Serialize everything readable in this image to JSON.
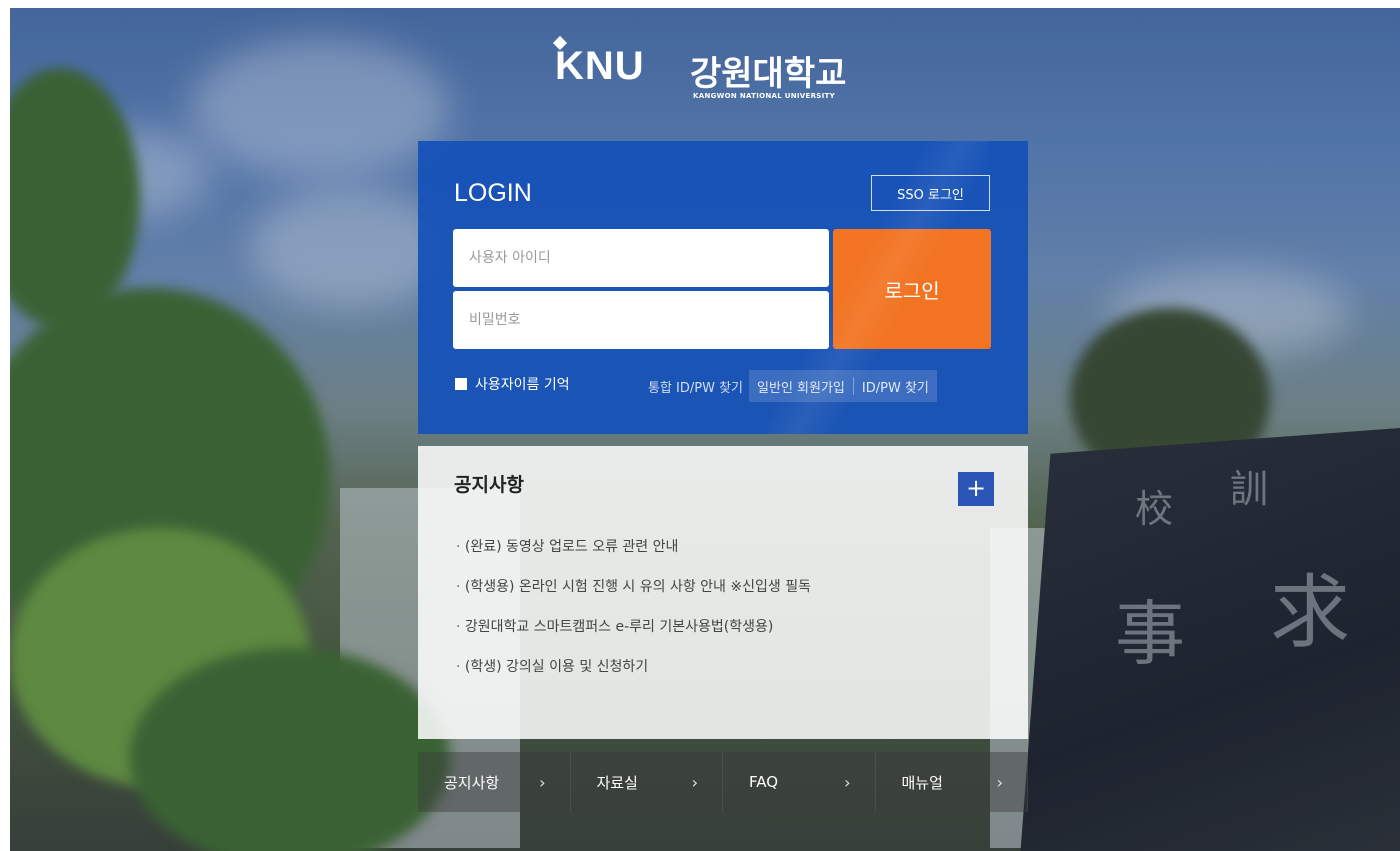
{
  "logo": {
    "brand": "KNU",
    "name_kr": "강원대학교",
    "name_en": "KANGWON NATIONAL UNIVERSITY"
  },
  "login": {
    "title": "LOGIN",
    "sso_label": "SSO 로그인",
    "id_placeholder": "사용자 아이디",
    "pw_placeholder": "비밀번호",
    "submit_label": "로그인",
    "remember_label": "사용자이름 기억",
    "find_unified": "통합 ID/PW 찾기",
    "signup": "일반인 회원가입",
    "find_idpw": "ID/PW 찾기"
  },
  "notice": {
    "title": "공지사항",
    "more_icon": "plus-icon",
    "items": [
      "(완료) 동영상 업로드 오류 관련 안내",
      "(학생용) 온라인 시험 진행 시 유의 사항 안내 ※신입생 필독",
      "강원대학교 스마트캠퍼스 e-루리 기본사용법(학생용)",
      "(학생) 강의실 이용 및 신청하기"
    ]
  },
  "menu": {
    "items": [
      "공지사항",
      "자료실",
      "FAQ",
      "매뉴얼"
    ]
  },
  "background": {
    "stone_chars": [
      "校",
      "訓",
      "事",
      "求"
    ]
  },
  "colors": {
    "login_bg": "#1450b9",
    "login_button": "#f27321",
    "notice_more": "#2b56b8"
  }
}
